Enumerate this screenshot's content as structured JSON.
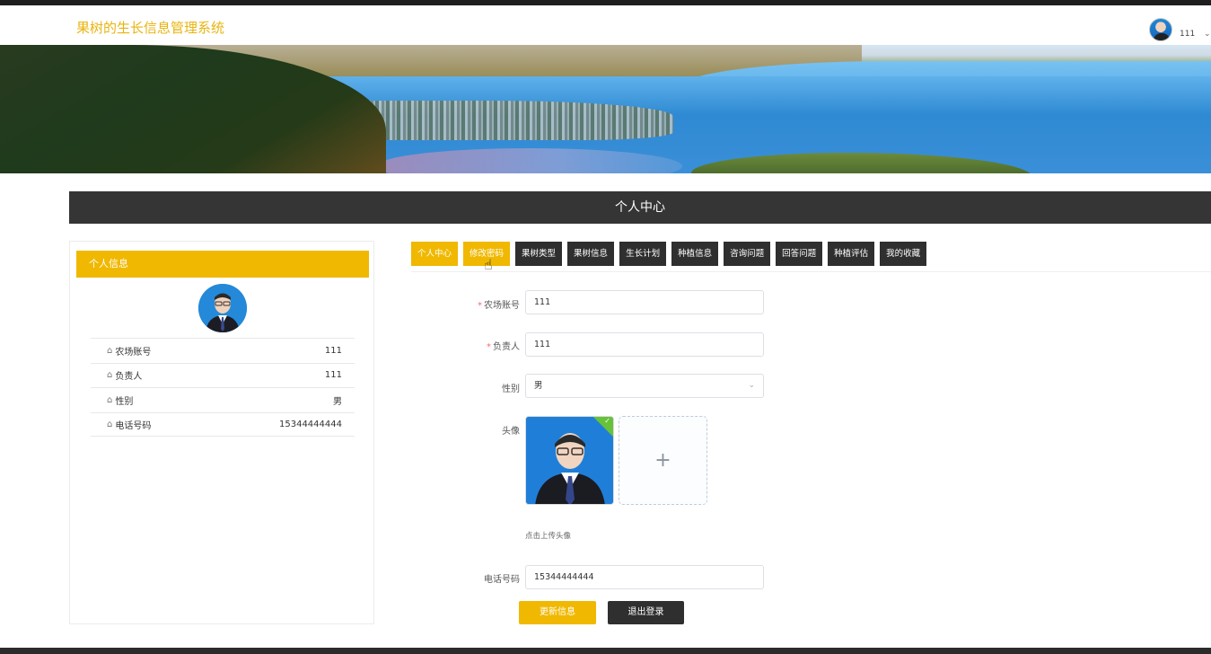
{
  "header": {
    "site_title": "果树的生长信息管理系统",
    "user_name": "111",
    "user_caret": "⌄"
  },
  "banner": {
    "slide_count": 2,
    "active_slide": 0
  },
  "section": {
    "title": "个人中心"
  },
  "profile_card": {
    "heading": "个人信息",
    "rows": [
      {
        "label": "农场账号",
        "value": "111"
      },
      {
        "label": "负责人",
        "value": "111"
      },
      {
        "label": "性别",
        "value": "男"
      },
      {
        "label": "电话号码",
        "value": "15344444444"
      }
    ]
  },
  "tabs": [
    {
      "label": "个人中心",
      "active": true
    },
    {
      "label": "修改密码",
      "active": false
    },
    {
      "label": "果树类型",
      "active": false
    },
    {
      "label": "果树信息",
      "active": false
    },
    {
      "label": "生长计划",
      "active": false
    },
    {
      "label": "种植信息",
      "active": false
    },
    {
      "label": "咨询问题",
      "active": false
    },
    {
      "label": "回答问题",
      "active": false
    },
    {
      "label": "种植评估",
      "active": false
    },
    {
      "label": "我的收藏",
      "active": false
    }
  ],
  "form": {
    "account": {
      "label": "农场账号",
      "value": "111",
      "required": true
    },
    "manager": {
      "label": "负责人",
      "value": "111",
      "required": true
    },
    "gender": {
      "label": "性别",
      "value": "男"
    },
    "avatar": {
      "label": "头像",
      "upload_tip": "点击上传头像",
      "add_symbol": "+"
    },
    "phone": {
      "label": "电话号码",
      "value": "15344444444"
    },
    "update_button": "更新信息",
    "logout_button": "退出登录"
  },
  "colors": {
    "accent": "#f0b800",
    "dark": "#2f2f2f",
    "required": "#f56c6c"
  }
}
